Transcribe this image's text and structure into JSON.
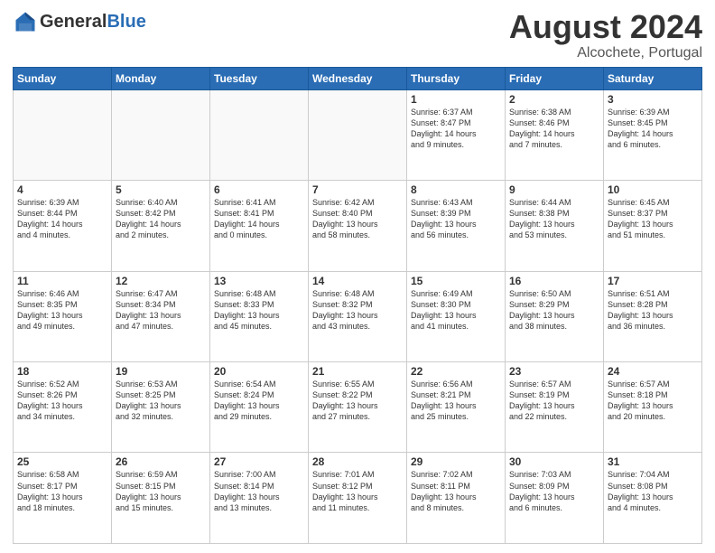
{
  "header": {
    "logo": {
      "general": "General",
      "blue": "Blue"
    },
    "title": "August 2024",
    "location": "Alcochete, Portugal"
  },
  "calendar": {
    "days_of_week": [
      "Sunday",
      "Monday",
      "Tuesday",
      "Wednesday",
      "Thursday",
      "Friday",
      "Saturday"
    ],
    "weeks": [
      [
        {
          "day": "",
          "info": ""
        },
        {
          "day": "",
          "info": ""
        },
        {
          "day": "",
          "info": ""
        },
        {
          "day": "",
          "info": ""
        },
        {
          "day": "1",
          "info": "Sunrise: 6:37 AM\nSunset: 8:47 PM\nDaylight: 14 hours\nand 9 minutes."
        },
        {
          "day": "2",
          "info": "Sunrise: 6:38 AM\nSunset: 8:46 PM\nDaylight: 14 hours\nand 7 minutes."
        },
        {
          "day": "3",
          "info": "Sunrise: 6:39 AM\nSunset: 8:45 PM\nDaylight: 14 hours\nand 6 minutes."
        }
      ],
      [
        {
          "day": "4",
          "info": "Sunrise: 6:39 AM\nSunset: 8:44 PM\nDaylight: 14 hours\nand 4 minutes."
        },
        {
          "day": "5",
          "info": "Sunrise: 6:40 AM\nSunset: 8:42 PM\nDaylight: 14 hours\nand 2 minutes."
        },
        {
          "day": "6",
          "info": "Sunrise: 6:41 AM\nSunset: 8:41 PM\nDaylight: 14 hours\nand 0 minutes."
        },
        {
          "day": "7",
          "info": "Sunrise: 6:42 AM\nSunset: 8:40 PM\nDaylight: 13 hours\nand 58 minutes."
        },
        {
          "day": "8",
          "info": "Sunrise: 6:43 AM\nSunset: 8:39 PM\nDaylight: 13 hours\nand 56 minutes."
        },
        {
          "day": "9",
          "info": "Sunrise: 6:44 AM\nSunset: 8:38 PM\nDaylight: 13 hours\nand 53 minutes."
        },
        {
          "day": "10",
          "info": "Sunrise: 6:45 AM\nSunset: 8:37 PM\nDaylight: 13 hours\nand 51 minutes."
        }
      ],
      [
        {
          "day": "11",
          "info": "Sunrise: 6:46 AM\nSunset: 8:35 PM\nDaylight: 13 hours\nand 49 minutes."
        },
        {
          "day": "12",
          "info": "Sunrise: 6:47 AM\nSunset: 8:34 PM\nDaylight: 13 hours\nand 47 minutes."
        },
        {
          "day": "13",
          "info": "Sunrise: 6:48 AM\nSunset: 8:33 PM\nDaylight: 13 hours\nand 45 minutes."
        },
        {
          "day": "14",
          "info": "Sunrise: 6:48 AM\nSunset: 8:32 PM\nDaylight: 13 hours\nand 43 minutes."
        },
        {
          "day": "15",
          "info": "Sunrise: 6:49 AM\nSunset: 8:30 PM\nDaylight: 13 hours\nand 41 minutes."
        },
        {
          "day": "16",
          "info": "Sunrise: 6:50 AM\nSunset: 8:29 PM\nDaylight: 13 hours\nand 38 minutes."
        },
        {
          "day": "17",
          "info": "Sunrise: 6:51 AM\nSunset: 8:28 PM\nDaylight: 13 hours\nand 36 minutes."
        }
      ],
      [
        {
          "day": "18",
          "info": "Sunrise: 6:52 AM\nSunset: 8:26 PM\nDaylight: 13 hours\nand 34 minutes."
        },
        {
          "day": "19",
          "info": "Sunrise: 6:53 AM\nSunset: 8:25 PM\nDaylight: 13 hours\nand 32 minutes."
        },
        {
          "day": "20",
          "info": "Sunrise: 6:54 AM\nSunset: 8:24 PM\nDaylight: 13 hours\nand 29 minutes."
        },
        {
          "day": "21",
          "info": "Sunrise: 6:55 AM\nSunset: 8:22 PM\nDaylight: 13 hours\nand 27 minutes."
        },
        {
          "day": "22",
          "info": "Sunrise: 6:56 AM\nSunset: 8:21 PM\nDaylight: 13 hours\nand 25 minutes."
        },
        {
          "day": "23",
          "info": "Sunrise: 6:57 AM\nSunset: 8:19 PM\nDaylight: 13 hours\nand 22 minutes."
        },
        {
          "day": "24",
          "info": "Sunrise: 6:57 AM\nSunset: 8:18 PM\nDaylight: 13 hours\nand 20 minutes."
        }
      ],
      [
        {
          "day": "25",
          "info": "Sunrise: 6:58 AM\nSunset: 8:17 PM\nDaylight: 13 hours\nand 18 minutes."
        },
        {
          "day": "26",
          "info": "Sunrise: 6:59 AM\nSunset: 8:15 PM\nDaylight: 13 hours\nand 15 minutes."
        },
        {
          "day": "27",
          "info": "Sunrise: 7:00 AM\nSunset: 8:14 PM\nDaylight: 13 hours\nand 13 minutes."
        },
        {
          "day": "28",
          "info": "Sunrise: 7:01 AM\nSunset: 8:12 PM\nDaylight: 13 hours\nand 11 minutes."
        },
        {
          "day": "29",
          "info": "Sunrise: 7:02 AM\nSunset: 8:11 PM\nDaylight: 13 hours\nand 8 minutes."
        },
        {
          "day": "30",
          "info": "Sunrise: 7:03 AM\nSunset: 8:09 PM\nDaylight: 13 hours\nand 6 minutes."
        },
        {
          "day": "31",
          "info": "Sunrise: 7:04 AM\nSunset: 8:08 PM\nDaylight: 13 hours\nand 4 minutes."
        }
      ]
    ]
  }
}
